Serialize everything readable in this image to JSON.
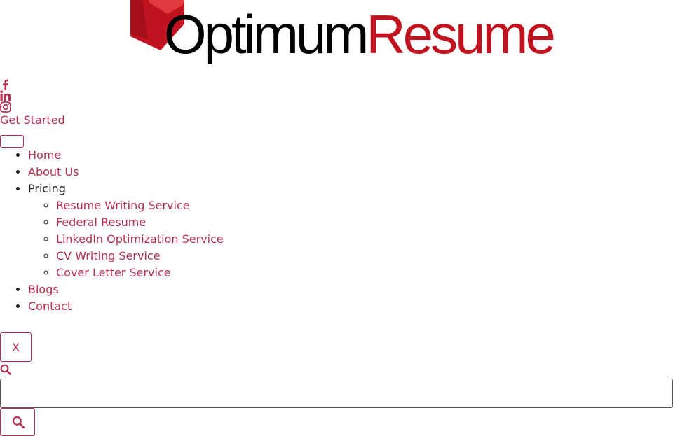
{
  "brand": {
    "logo_word_1": "Optimum",
    "logo_word_2": "Resume",
    "colors": {
      "black": "#000000",
      "red": "#c1121f",
      "link": "#b5314f"
    }
  },
  "social": [
    "facebook-icon",
    "linkedin-icon",
    "instagram-icon"
  ],
  "header": {
    "cta_label": "Get Started"
  },
  "nav": {
    "items": [
      {
        "label": "Home"
      },
      {
        "label": "About Us"
      },
      {
        "label": "Pricing",
        "children": [
          {
            "label": "Resume Writing Service"
          },
          {
            "label": "Federal Resume"
          },
          {
            "label": "LinkedIn Optimization Service"
          },
          {
            "label": "CV Writing Service"
          },
          {
            "label": "Cover Letter Service"
          }
        ]
      },
      {
        "label": "Blogs"
      },
      {
        "label": "Contact"
      }
    ]
  },
  "search": {
    "close_label": "X",
    "input_value": "",
    "placeholder": ""
  }
}
